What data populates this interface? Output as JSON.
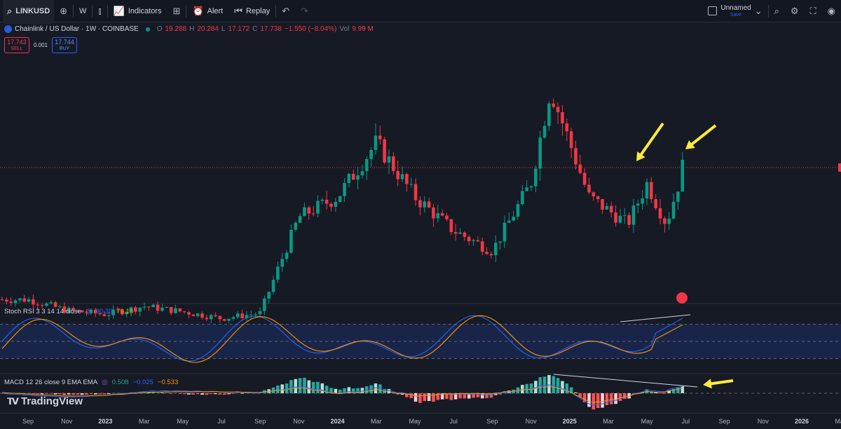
{
  "toolbar": {
    "symbol": "LINKUSD",
    "interval": "W",
    "indicators_label": "Indicators",
    "alert_label": "Alert",
    "replay_label": "Replay",
    "layout_name": "Unnamed",
    "layout_status": "Save"
  },
  "legend": {
    "title": "Chainlink / US Dollar · 1W · COINBASE",
    "open_label": "O",
    "open": "19.288",
    "high_label": "H",
    "high": "20.284",
    "low_label": "L",
    "low": "17.172",
    "close_label": "C",
    "close": "17.738",
    "change": "−1.550 (−8.04%)",
    "vol_label": "Vol",
    "vol": "9.99 M"
  },
  "trade": {
    "sell_price": "17.743",
    "sell_label": "SELL",
    "spread": "0.001",
    "buy_price": "17.744",
    "buy_label": "BUY"
  },
  "stoch": {
    "label": "Stoch RSI 3 3 14 14 close",
    "k": "90.39",
    "d": "79.18"
  },
  "macd": {
    "label": "MACD 12 26 close 9 EMA EMA",
    "hist": "0.508",
    "macd": "−0.025",
    "signal": "−0.533"
  },
  "brand": "TradingView",
  "colors": {
    "up": "#089981",
    "down": "#f23645",
    "bg": "#161a25",
    "accent": "#2962ff",
    "annotation": "#ffeb3b"
  },
  "chart_data": [
    {
      "type": "candlestick",
      "title": "Chainlink / US Dollar · 1W · COINBASE",
      "x_ticks": [
        "Sep",
        "Nov",
        "2023",
        "Mar",
        "May",
        "Jul",
        "Sep",
        "Nov",
        "2024",
        "Mar",
        "May",
        "Jul",
        "Sep",
        "Nov",
        "2025",
        "Mar",
        "May",
        "Jul",
        "Sep",
        "Nov",
        "2026",
        "Mar"
      ],
      "approx_close_by_month": [
        {
          "x": "2022-09",
          "close": 7.4
        },
        {
          "x": "2022-11",
          "close": 6.6
        },
        {
          "x": "2023-01",
          "close": 6.3
        },
        {
          "x": "2023-03",
          "close": 6.9
        },
        {
          "x": "2023-05",
          "close": 6.5
        },
        {
          "x": "2023-07",
          "close": 6.0
        },
        {
          "x": "2023-09",
          "close": 6.4
        },
        {
          "x": "2023-11",
          "close": 13.5
        },
        {
          "x": "2024-01",
          "close": 15.0
        },
        {
          "x": "2024-03",
          "close": 19.0
        },
        {
          "x": "2024-05",
          "close": 15.0
        },
        {
          "x": "2024-07",
          "close": 12.5
        },
        {
          "x": "2024-09",
          "close": 11.0
        },
        {
          "x": "2024-11",
          "close": 16.0
        },
        {
          "x": "2024-12",
          "close": 23.0
        },
        {
          "x": "2025-02",
          "close": 15.0
        },
        {
          "x": "2025-04",
          "close": 13.0
        },
        {
          "x": "2025-05",
          "close": 16.0
        },
        {
          "x": "2025-06",
          "close": 13.0
        },
        {
          "x": "2025-07",
          "close": 17.738
        }
      ],
      "last_price": 17.738
    },
    {
      "type": "line",
      "title": "Stoch RSI 3 3 14 14 close",
      "series": [
        {
          "name": "K",
          "last": 90.39
        },
        {
          "name": "D",
          "last": 79.18
        }
      ],
      "bands": [
        80,
        50,
        20
      ]
    },
    {
      "type": "bar",
      "title": "MACD 12 26 close 9 EMA EMA",
      "series": [
        {
          "name": "Histogram",
          "last": 0.508
        },
        {
          "name": "MACD",
          "last": -0.025
        },
        {
          "name": "Signal",
          "last": -0.533
        }
      ]
    }
  ]
}
